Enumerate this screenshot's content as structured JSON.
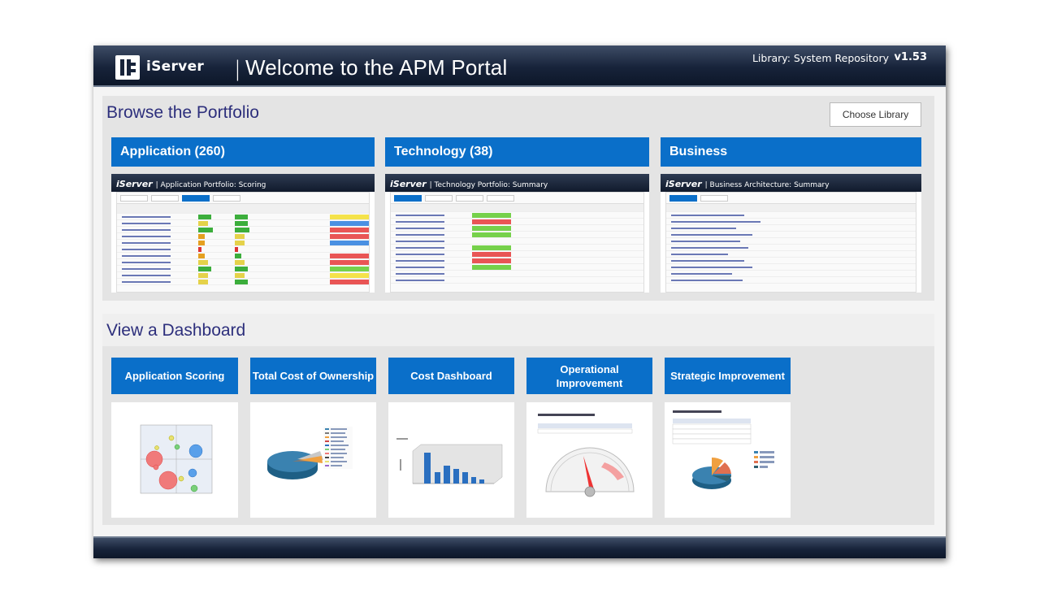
{
  "header": {
    "logo_text": "iServer",
    "separator": "|",
    "title": "Welcome to the APM Portal",
    "library": "Library: System Repository",
    "version": "v1.53"
  },
  "browse": {
    "title": "Browse the Portfolio",
    "choose_library": "Choose Library",
    "cards": [
      {
        "label": "Application (260)",
        "thumb_brand": "iServer",
        "thumb_title": "| Application Portfolio: Scoring"
      },
      {
        "label": "Technology (38)",
        "thumb_brand": "iServer",
        "thumb_title": "| Technology Portfolio: Summary"
      },
      {
        "label": "Business",
        "thumb_brand": "iServer",
        "thumb_title": "| Business Architecture: Summary"
      }
    ]
  },
  "dashboard": {
    "title": "View a Dashboard",
    "cards": [
      {
        "label": "Application Scoring",
        "icon": "bubble-chart-icon"
      },
      {
        "label": "Total Cost of Ownership",
        "icon": "pie-chart-icon"
      },
      {
        "label": "Cost Dashboard",
        "icon": "bar-chart-icon"
      },
      {
        "label": "Operational Improvement",
        "icon": "gauge-chart-icon"
      },
      {
        "label": "Strategic Improvement",
        "icon": "pie-table-chart-icon"
      }
    ]
  },
  "colors": {
    "accent": "#0a6fc9",
    "header": "#17233a",
    "section_title": "#2d2f7c"
  }
}
